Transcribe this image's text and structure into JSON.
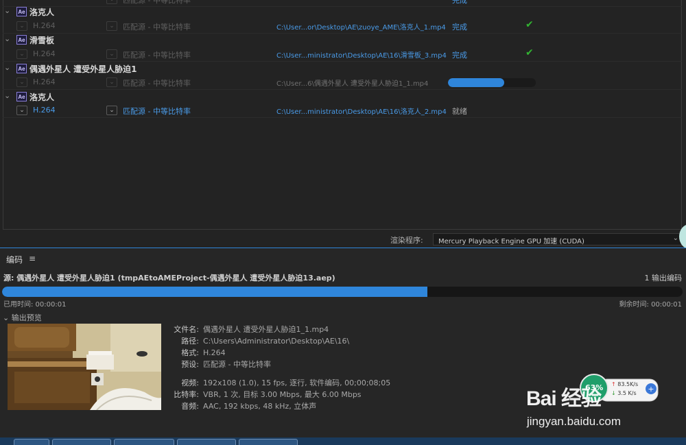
{
  "queue": {
    "top_row": {
      "preset": "匹配源 - 中等比特率",
      "status": "完成"
    },
    "items": [
      {
        "name": "洛克人",
        "format": "H.264",
        "preset": "匹配源 - 中等比特率",
        "path": "C:\\User...or\\Desktop\\AE\\zuoye_AME\\洛克人_1.mp4",
        "status": "完成",
        "state": "done"
      },
      {
        "name": "滑雪板",
        "format": "H.264",
        "preset": "匹配源 - 中等比特率",
        "path": "C:\\User...ministrator\\Desktop\\AE\\16\\滑雪板_3.mp4",
        "status": "完成",
        "state": "done"
      },
      {
        "name": "偶遇外星人 遭受外星人胁迫1",
        "format": "H.264",
        "preset": "匹配源 - 中等比特率",
        "path": "C:\\User...6\\偶遇外星人 遭受外星人胁迫1_1.mp4",
        "progress": 0.64,
        "state": "encoding"
      },
      {
        "name": "洛克人",
        "format": "H.264",
        "preset": "匹配源 - 中等比特率",
        "path": "C:\\User...ministrator\\Desktop\\AE\\16\\洛克人_2.mp4",
        "status": "就绪",
        "state": "ready"
      }
    ],
    "renderer_label": "渲染程序:",
    "renderer_value": "Mercury Playback Engine GPU 加速 (CUDA)"
  },
  "encoding": {
    "title": "编码",
    "menu_icon": "hamburger-icon",
    "source": "源: 偶遇外星人 遭受外星人胁迫1 (tmpAEtoAMEProject-偶遇外星人 遭受外星人胁迫13.aep)",
    "output_count": "1 输出编码",
    "progress": 0.625,
    "elapsed": "已用时间: 00:00:01",
    "remaining": "剩余时间: 00:00:01",
    "preview_header": "输出预览",
    "details": {
      "filename_label": "文件名:",
      "filename": "偶遇外星人 遭受外星人胁迫1_1.mp4",
      "path_label": "路径:",
      "path": "C:\\Users\\Administrator\\Desktop\\AE\\16\\",
      "format_label": "格式:",
      "format": "H.264",
      "preset_label": "预设:",
      "preset": "匹配源 - 中等比特率",
      "video_label": "视频:",
      "video": "192x108 (1.0), 15 fps, 逐行, 软件编码, 00;00;08;05",
      "bitrate_label": "比特率:",
      "bitrate": "VBR, 1 次, 目标 3.00 Mbps, 最大 6.00 Mbps",
      "audio_label": "音频:",
      "audio": "AAC, 192 kbps, 48 kHz, 立体声"
    }
  },
  "overlay": {
    "cpu_percent": "63%",
    "upload": "83.5K/s",
    "download": "3.5 K/s",
    "watermark": "Bai 经验",
    "watermark_url": "jingyan.baidu.com"
  },
  "colors": {
    "accent": "#2f86db",
    "link": "#4a9be8",
    "success": "#32b432",
    "bg": "#232323"
  }
}
